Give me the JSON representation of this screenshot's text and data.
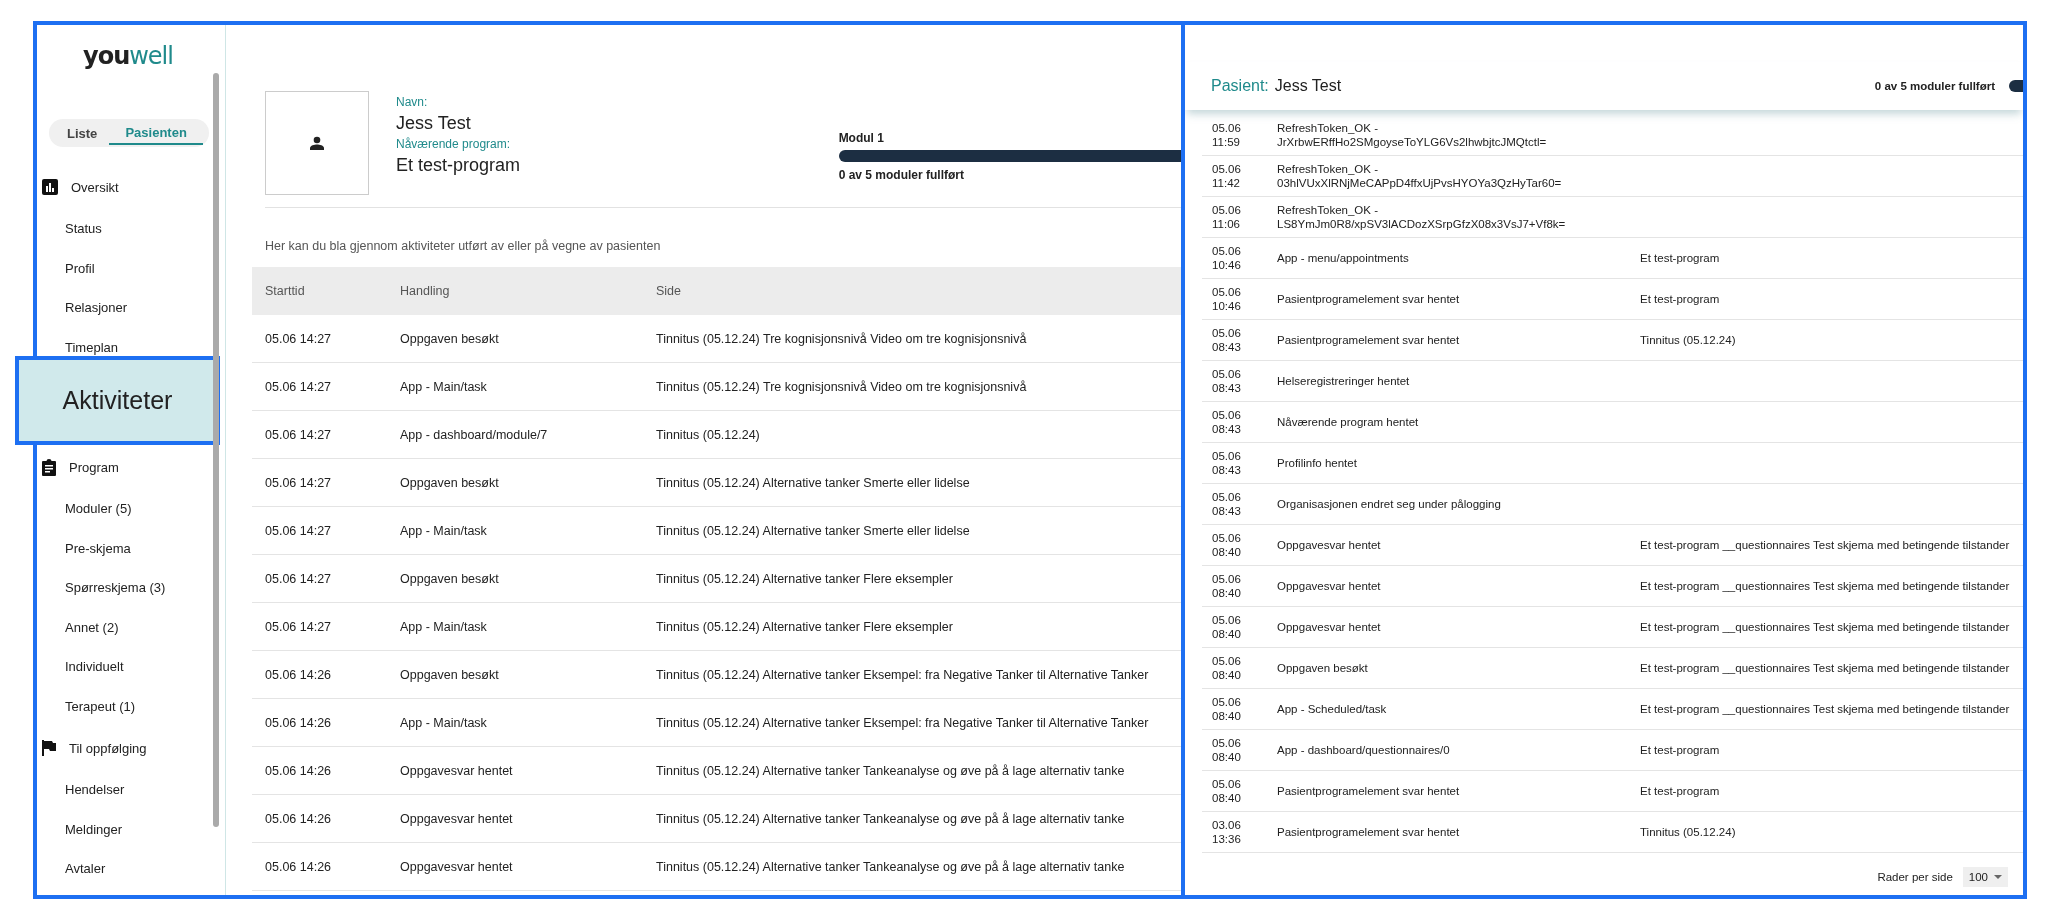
{
  "logo": {
    "dark_part": "you",
    "teal_part": "well"
  },
  "sidebar": {
    "tabs": [
      {
        "label": "Liste",
        "selected": false
      },
      {
        "label": "Pasienten",
        "selected": true
      }
    ],
    "sections": [
      {
        "label": "Oversikt",
        "items": [
          "Status",
          "Profil",
          "Relasjoner",
          "Timeplan"
        ]
      },
      {
        "label": "Program",
        "items": [
          "Moduler (5)",
          "Pre-skjema",
          "Spørreskjema (3)",
          "Annet (2)",
          "Individuelt",
          "Terapeut (1)"
        ]
      },
      {
        "label": "Til oppfølging",
        "items": [
          "Hendelser",
          "Meldinger",
          "Avtaler"
        ]
      }
    ]
  },
  "callout": {
    "label": "Aktiviteter"
  },
  "patient": {
    "name_label": "Navn:",
    "name": "Jess Test",
    "program_label": "Nåværende program:",
    "program": "Et test-program",
    "module": "Modul 1",
    "level": 1,
    "progress_text": "0 av 5 moduler fullført"
  },
  "description": "Her kan du bla gjennom aktiviteter utført av eller på vegne av pasienten",
  "table": {
    "columns": [
      "Starttid",
      "Handling",
      "Side"
    ],
    "rows": [
      {
        "time": "05.06 14:27",
        "action": "Oppgaven besøkt",
        "side": "Tinnitus (05.12.24) Tre kognisjonsnivå Video om tre kognisjonsnivå"
      },
      {
        "time": "05.06 14:27",
        "action": "App - Main/task",
        "side": "Tinnitus (05.12.24) Tre kognisjonsnivå Video om tre kognisjonsnivå"
      },
      {
        "time": "05.06 14:27",
        "action": "App - dashboard/module/7",
        "side": "Tinnitus (05.12.24)"
      },
      {
        "time": "05.06 14:27",
        "action": "Oppgaven besøkt",
        "side": "Tinnitus (05.12.24) Alternative tanker Smerte eller lidelse"
      },
      {
        "time": "05.06 14:27",
        "action": "App - Main/task",
        "side": "Tinnitus (05.12.24) Alternative tanker Smerte eller lidelse"
      },
      {
        "time": "05.06 14:27",
        "action": "Oppgaven besøkt",
        "side": "Tinnitus (05.12.24) Alternative tanker Flere eksempler"
      },
      {
        "time": "05.06 14:27",
        "action": "App - Main/task",
        "side": "Tinnitus (05.12.24) Alternative tanker Flere eksempler"
      },
      {
        "time": "05.06 14:26",
        "action": "Oppgaven besøkt",
        "side": "Tinnitus (05.12.24) Alternative tanker Eksempel: fra Negative Tanker til Alternative Tanker"
      },
      {
        "time": "05.06 14:26",
        "action": "App - Main/task",
        "side": "Tinnitus (05.12.24) Alternative tanker Eksempel: fra Negative Tanker til Alternative Tanker"
      },
      {
        "time": "05.06 14:26",
        "action": "Oppgavesvar hentet",
        "side": "Tinnitus (05.12.24) Alternative tanker Tankeanalyse og øve på å lage alternativ tanke"
      },
      {
        "time": "05.06 14:26",
        "action": "Oppgavesvar hentet",
        "side": "Tinnitus (05.12.24) Alternative tanker Tankeanalyse og øve på å lage alternativ tanke"
      },
      {
        "time": "05.06 14:26",
        "action": "Oppgavesvar hentet",
        "side": "Tinnitus (05.12.24) Alternative tanker Tankeanalyse og øve på å lage alternativ tanke"
      }
    ]
  },
  "detail_view": {
    "header": {
      "label": "Pasient:",
      "name": "Jess Test",
      "progress_text": "0 av 5 moduler fullført",
      "level": 1
    },
    "rows": [
      {
        "time": "05.06 11:59",
        "action": "RefreshToken_OK - JrXrbwERffHo2SMgoyseToYLG6Vs2lhwbjtcJMQtctl="
      },
      {
        "time": "05.06 11:42",
        "action": "RefreshToken_OK - 03hlVUxXlRNjMeCAPpD4ffxUjPvsHYOYa3QzHyTar60="
      },
      {
        "time": "05.06 11:06",
        "action": "RefreshToken_OK - LS8YmJm0R8/xpSV3lACDozXSrpGfzX08x3VsJ7+Vf8k="
      },
      {
        "time": "05.06 10:46",
        "action": "App - menu/appointments",
        "side": "Et test-program"
      },
      {
        "time": "05.06 10:46",
        "action": "Pasientprogramelement svar hentet",
        "side": "Et test-program"
      },
      {
        "time": "05.06 08:43",
        "action": "Pasientprogramelement svar hentet",
        "side": "Tinnitus (05.12.24)"
      },
      {
        "time": "05.06 08:43",
        "action": "Helseregistreringer hentet"
      },
      {
        "time": "05.06 08:43",
        "action": "Nåværende program hentet"
      },
      {
        "time": "05.06 08:43",
        "action": "Profilinfo hentet"
      },
      {
        "time": "05.06 08:43",
        "action": "Organisasjonen endret seg under pålogging"
      },
      {
        "time": "05.06 08:40",
        "action": "Oppgavesvar hentet",
        "side": "Et test-program __questionnaires Test skjema med betingende tilstander"
      },
      {
        "time": "05.06 08:40",
        "action": "Oppgavesvar hentet",
        "side": "Et test-program __questionnaires Test skjema med betingende tilstander"
      },
      {
        "time": "05.06 08:40",
        "action": "Oppgavesvar hentet",
        "side": "Et test-program __questionnaires Test skjema med betingende tilstander"
      },
      {
        "time": "05.06 08:40",
        "action": "Oppgaven besøkt",
        "side": "Et test-program __questionnaires Test skjema med betingende tilstander"
      },
      {
        "time": "05.06 08:40",
        "action": "App - Scheduled/task",
        "side": "Et test-program __questionnaires Test skjema med betingende tilstander"
      },
      {
        "time": "05.06 08:40",
        "action": "App - dashboard/questionnaires/0",
        "side": "Et test-program"
      },
      {
        "time": "05.06 08:40",
        "action": "Pasientprogramelement svar hentet",
        "side": "Et test-program"
      },
      {
        "time": "03.06 13:36",
        "action": "Pasientprogramelement svar hentet",
        "side": "Tinnitus (05.12.24)"
      }
    ],
    "footer": {
      "label": "Rader per side",
      "page_size": "100"
    }
  }
}
